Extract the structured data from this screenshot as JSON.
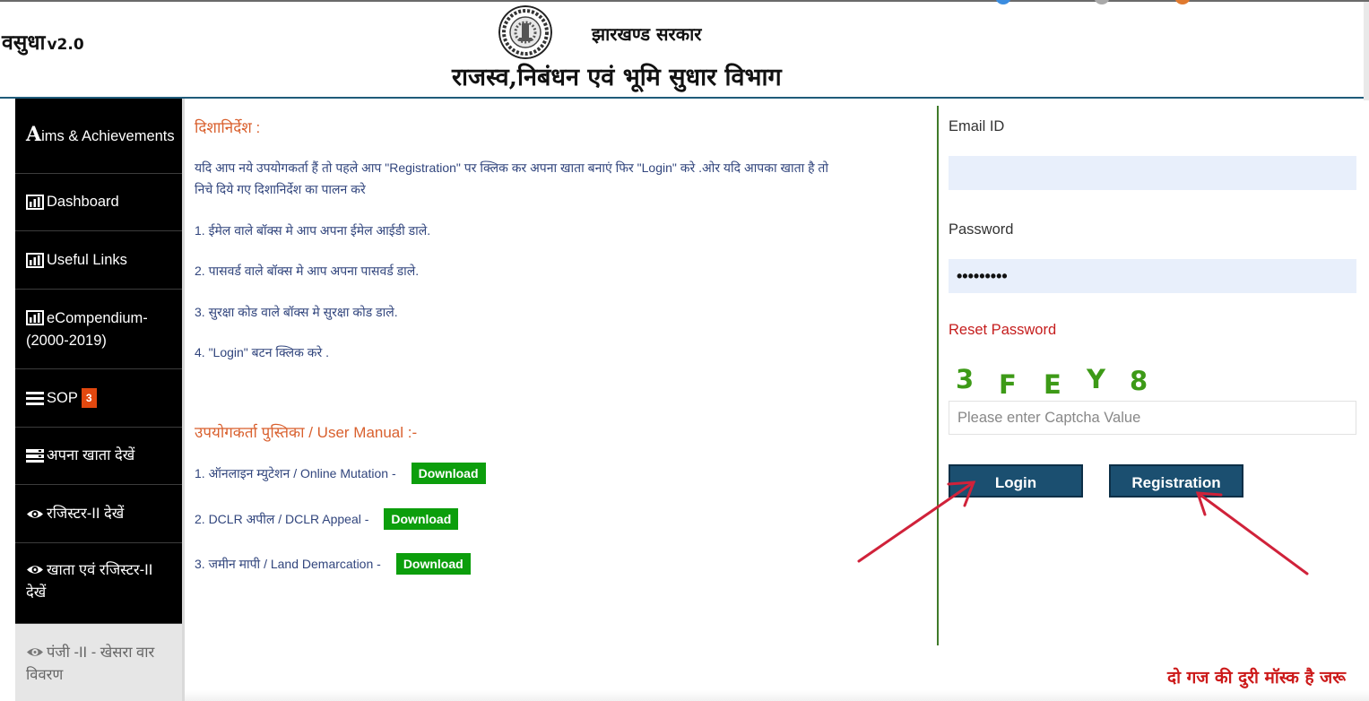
{
  "header": {
    "brand_main": "वसुधा",
    "brand_version": "v2.0",
    "gov_name": "झारखण्ड सरकार",
    "dept_name": "राजस्व,निबंधन एवं भूमि सुधार  विभाग"
  },
  "sidebar": {
    "items": [
      {
        "label_first": "A",
        "label_rest": "ims & Achievements",
        "icon": "letter-a"
      },
      {
        "label": "Dashboard",
        "icon": "bar-chart-icon"
      },
      {
        "label": "Useful Links",
        "icon": "bar-chart-icon"
      },
      {
        "label": "eCompendium-(2000-2019)",
        "icon": "bar-chart-icon"
      },
      {
        "label": "SOP",
        "badge": "3",
        "icon": "list-icon"
      },
      {
        "label": "अपना खाता देखें",
        "icon": "card-list-icon"
      },
      {
        "label": "रजिस्टर-II देखें",
        "icon": "eye-icon"
      },
      {
        "label": "खाता एवं रजिस्टर-II देखें",
        "icon": "eye-icon"
      },
      {
        "label": "पंजी -II - खेसरा वार विवरण",
        "icon": "eye-icon"
      }
    ]
  },
  "guidelines": {
    "title": "दिशानिर्देश :",
    "intro_line1": "यदि आप नये उपयोगकर्ता हैं तो पहले आप \"Registration\" पर क्लिक कर अपना खाता बनाएं फिर \"Login\" करे .ओर यदि आपका खाता है तो",
    "intro_line2": "निचे दिये गए दिशानिर्देश का पालन करे",
    "steps": [
      "1. ईमेल वाले बॉक्स मे आप अपना ईमेल आईडी डाले.",
      "2. पासवर्ड वाले बॉक्स मे आप अपना पासवर्ड डाले.",
      "3. सुरक्षा कोड वाले बॉक्स मे सुरक्षा कोड डाले.",
      "4. \"Login\" बटन क्लिक करे ."
    ]
  },
  "manual": {
    "title": "उपयोगकर्ता पुस्तिका / User Manual :-",
    "download_label": "Download",
    "items": [
      "1. ऑनलाइन म्युटेशन / Online Mutation -",
      "2. DCLR अपील / DCLR Appeal -",
      "3. जमीन मापी / Land Demarcation -"
    ]
  },
  "login": {
    "email_label": "Email ID",
    "email_value": "",
    "password_label": "Password",
    "password_value": "•••••••••",
    "reset_label": "Reset Password",
    "captcha_chars": [
      "3",
      "F",
      "E",
      "Y",
      "8"
    ],
    "captcha_placeholder": "Please enter Captcha Value",
    "login_button": "Login",
    "registration_button": "Registration"
  },
  "marquee": "दो गज की दुरी मॉस्क है जरू",
  "colors": {
    "sidebar_bg": "#000000",
    "accent_orange": "#d9602e",
    "text_blue": "#31457d",
    "download_green": "#0c9e0c",
    "button_blue": "#1b4f70",
    "reset_red": "#c51d1d",
    "captcha_green": "#3d9a17",
    "divider_green": "#3f7a2a",
    "annotation_arrow": "#d0223a"
  }
}
